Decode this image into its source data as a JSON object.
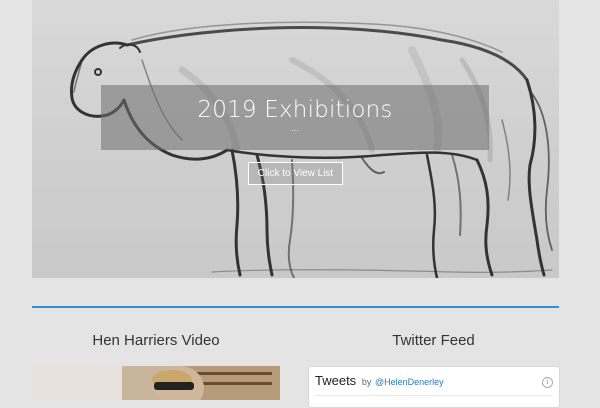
{
  "hero": {
    "title": "2019 Exhibitions",
    "subtitle": "...",
    "button_label": "Click to View List"
  },
  "columns": {
    "video_title": "Hen Harriers Video",
    "twitter_title": "Twitter Feed"
  },
  "twitter": {
    "heading": "Tweets",
    "by": "by",
    "handle": "@HelenDenerley",
    "info_icon": "info-icon"
  },
  "colors": {
    "page_background": "#e4e4e4",
    "divider": "#2e8fde",
    "hero_overlay": "rgba(110,110,110,0.55)",
    "twitter_handle": "#2b7bb9"
  }
}
